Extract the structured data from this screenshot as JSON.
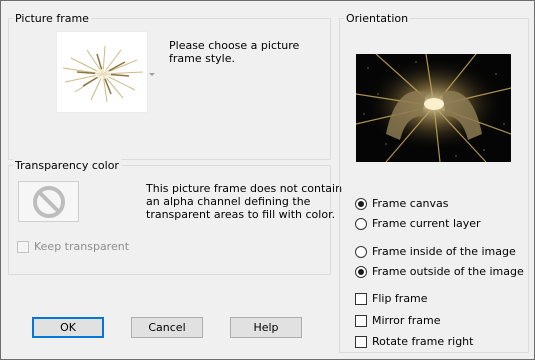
{
  "picture_frame": {
    "title": "Picture frame",
    "instruction": "Please choose a picture frame style."
  },
  "transparency": {
    "title": "Transparency color",
    "message": [
      "This picture frame does not contain",
      "an alpha channel defining the",
      "transparent areas to fill with color."
    ],
    "keep_transparent": {
      "label": "Keep transparent",
      "checked": false,
      "enabled": false
    }
  },
  "orientation": {
    "title": "Orientation",
    "radios_group1": [
      {
        "label": "Frame canvas",
        "checked": true
      },
      {
        "label": "Frame current layer",
        "checked": false
      }
    ],
    "radios_group2": [
      {
        "label": "Frame inside of the image",
        "checked": false
      },
      {
        "label": "Frame outside of the image",
        "checked": true
      }
    ],
    "checkboxes": [
      {
        "label": "Flip frame",
        "checked": false
      },
      {
        "label": "Mirror frame",
        "checked": false
      },
      {
        "label": "Rotate frame right",
        "checked": false
      }
    ]
  },
  "buttons": {
    "ok": "OK",
    "cancel": "Cancel",
    "help": "Help"
  },
  "icons": {
    "frame_thumbnail": "gold-starburst-frame-thumbnail",
    "no_transparency": "no-entry-icon",
    "dropdown": "chevron-down-icon"
  },
  "colors": {
    "dialog_bg": "#f0f0f0",
    "accent": "#0078d7",
    "preview_bg": "#000000"
  }
}
